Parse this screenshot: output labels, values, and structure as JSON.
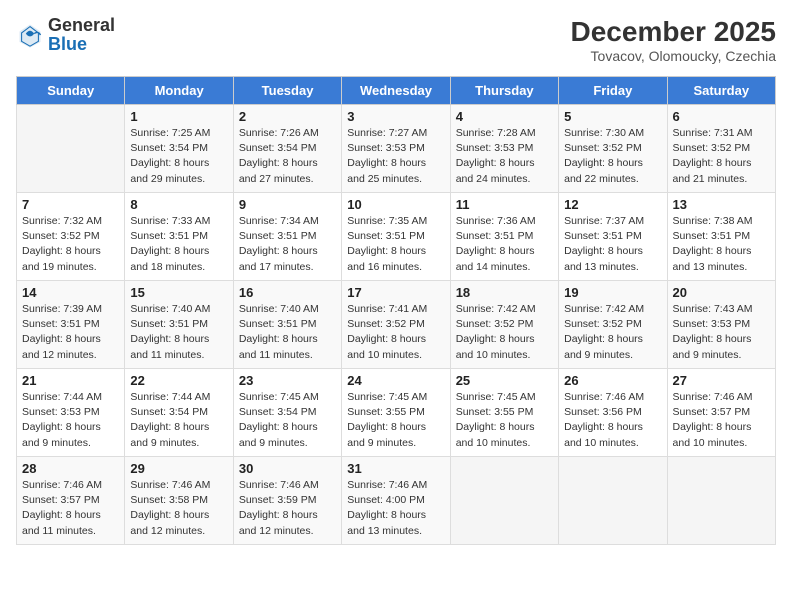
{
  "header": {
    "logo_general": "General",
    "logo_blue": "Blue",
    "month_year": "December 2025",
    "location": "Tovacov, Olomoucky, Czechia"
  },
  "days_of_week": [
    "Sunday",
    "Monday",
    "Tuesday",
    "Wednesday",
    "Thursday",
    "Friday",
    "Saturday"
  ],
  "weeks": [
    [
      {
        "day": "",
        "sunrise": "",
        "sunset": "",
        "daylight": ""
      },
      {
        "day": "1",
        "sunrise": "Sunrise: 7:25 AM",
        "sunset": "Sunset: 3:54 PM",
        "daylight": "Daylight: 8 hours and 29 minutes."
      },
      {
        "day": "2",
        "sunrise": "Sunrise: 7:26 AM",
        "sunset": "Sunset: 3:54 PM",
        "daylight": "Daylight: 8 hours and 27 minutes."
      },
      {
        "day": "3",
        "sunrise": "Sunrise: 7:27 AM",
        "sunset": "Sunset: 3:53 PM",
        "daylight": "Daylight: 8 hours and 25 minutes."
      },
      {
        "day": "4",
        "sunrise": "Sunrise: 7:28 AM",
        "sunset": "Sunset: 3:53 PM",
        "daylight": "Daylight: 8 hours and 24 minutes."
      },
      {
        "day": "5",
        "sunrise": "Sunrise: 7:30 AM",
        "sunset": "Sunset: 3:52 PM",
        "daylight": "Daylight: 8 hours and 22 minutes."
      },
      {
        "day": "6",
        "sunrise": "Sunrise: 7:31 AM",
        "sunset": "Sunset: 3:52 PM",
        "daylight": "Daylight: 8 hours and 21 minutes."
      }
    ],
    [
      {
        "day": "7",
        "sunrise": "Sunrise: 7:32 AM",
        "sunset": "Sunset: 3:52 PM",
        "daylight": "Daylight: 8 hours and 19 minutes."
      },
      {
        "day": "8",
        "sunrise": "Sunrise: 7:33 AM",
        "sunset": "Sunset: 3:51 PM",
        "daylight": "Daylight: 8 hours and 18 minutes."
      },
      {
        "day": "9",
        "sunrise": "Sunrise: 7:34 AM",
        "sunset": "Sunset: 3:51 PM",
        "daylight": "Daylight: 8 hours and 17 minutes."
      },
      {
        "day": "10",
        "sunrise": "Sunrise: 7:35 AM",
        "sunset": "Sunset: 3:51 PM",
        "daylight": "Daylight: 8 hours and 16 minutes."
      },
      {
        "day": "11",
        "sunrise": "Sunrise: 7:36 AM",
        "sunset": "Sunset: 3:51 PM",
        "daylight": "Daylight: 8 hours and 14 minutes."
      },
      {
        "day": "12",
        "sunrise": "Sunrise: 7:37 AM",
        "sunset": "Sunset: 3:51 PM",
        "daylight": "Daylight: 8 hours and 13 minutes."
      },
      {
        "day": "13",
        "sunrise": "Sunrise: 7:38 AM",
        "sunset": "Sunset: 3:51 PM",
        "daylight": "Daylight: 8 hours and 13 minutes."
      }
    ],
    [
      {
        "day": "14",
        "sunrise": "Sunrise: 7:39 AM",
        "sunset": "Sunset: 3:51 PM",
        "daylight": "Daylight: 8 hours and 12 minutes."
      },
      {
        "day": "15",
        "sunrise": "Sunrise: 7:40 AM",
        "sunset": "Sunset: 3:51 PM",
        "daylight": "Daylight: 8 hours and 11 minutes."
      },
      {
        "day": "16",
        "sunrise": "Sunrise: 7:40 AM",
        "sunset": "Sunset: 3:51 PM",
        "daylight": "Daylight: 8 hours and 11 minutes."
      },
      {
        "day": "17",
        "sunrise": "Sunrise: 7:41 AM",
        "sunset": "Sunset: 3:52 PM",
        "daylight": "Daylight: 8 hours and 10 minutes."
      },
      {
        "day": "18",
        "sunrise": "Sunrise: 7:42 AM",
        "sunset": "Sunset: 3:52 PM",
        "daylight": "Daylight: 8 hours and 10 minutes."
      },
      {
        "day": "19",
        "sunrise": "Sunrise: 7:42 AM",
        "sunset": "Sunset: 3:52 PM",
        "daylight": "Daylight: 8 hours and 9 minutes."
      },
      {
        "day": "20",
        "sunrise": "Sunrise: 7:43 AM",
        "sunset": "Sunset: 3:53 PM",
        "daylight": "Daylight: 8 hours and 9 minutes."
      }
    ],
    [
      {
        "day": "21",
        "sunrise": "Sunrise: 7:44 AM",
        "sunset": "Sunset: 3:53 PM",
        "daylight": "Daylight: 8 hours and 9 minutes."
      },
      {
        "day": "22",
        "sunrise": "Sunrise: 7:44 AM",
        "sunset": "Sunset: 3:54 PM",
        "daylight": "Daylight: 8 hours and 9 minutes."
      },
      {
        "day": "23",
        "sunrise": "Sunrise: 7:45 AM",
        "sunset": "Sunset: 3:54 PM",
        "daylight": "Daylight: 8 hours and 9 minutes."
      },
      {
        "day": "24",
        "sunrise": "Sunrise: 7:45 AM",
        "sunset": "Sunset: 3:55 PM",
        "daylight": "Daylight: 8 hours and 9 minutes."
      },
      {
        "day": "25",
        "sunrise": "Sunrise: 7:45 AM",
        "sunset": "Sunset: 3:55 PM",
        "daylight": "Daylight: 8 hours and 10 minutes."
      },
      {
        "day": "26",
        "sunrise": "Sunrise: 7:46 AM",
        "sunset": "Sunset: 3:56 PM",
        "daylight": "Daylight: 8 hours and 10 minutes."
      },
      {
        "day": "27",
        "sunrise": "Sunrise: 7:46 AM",
        "sunset": "Sunset: 3:57 PM",
        "daylight": "Daylight: 8 hours and 10 minutes."
      }
    ],
    [
      {
        "day": "28",
        "sunrise": "Sunrise: 7:46 AM",
        "sunset": "Sunset: 3:57 PM",
        "daylight": "Daylight: 8 hours and 11 minutes."
      },
      {
        "day": "29",
        "sunrise": "Sunrise: 7:46 AM",
        "sunset": "Sunset: 3:58 PM",
        "daylight": "Daylight: 8 hours and 12 minutes."
      },
      {
        "day": "30",
        "sunrise": "Sunrise: 7:46 AM",
        "sunset": "Sunset: 3:59 PM",
        "daylight": "Daylight: 8 hours and 12 minutes."
      },
      {
        "day": "31",
        "sunrise": "Sunrise: 7:46 AM",
        "sunset": "Sunset: 4:00 PM",
        "daylight": "Daylight: 8 hours and 13 minutes."
      },
      {
        "day": "",
        "sunrise": "",
        "sunset": "",
        "daylight": ""
      },
      {
        "day": "",
        "sunrise": "",
        "sunset": "",
        "daylight": ""
      },
      {
        "day": "",
        "sunrise": "",
        "sunset": "",
        "daylight": ""
      }
    ]
  ]
}
